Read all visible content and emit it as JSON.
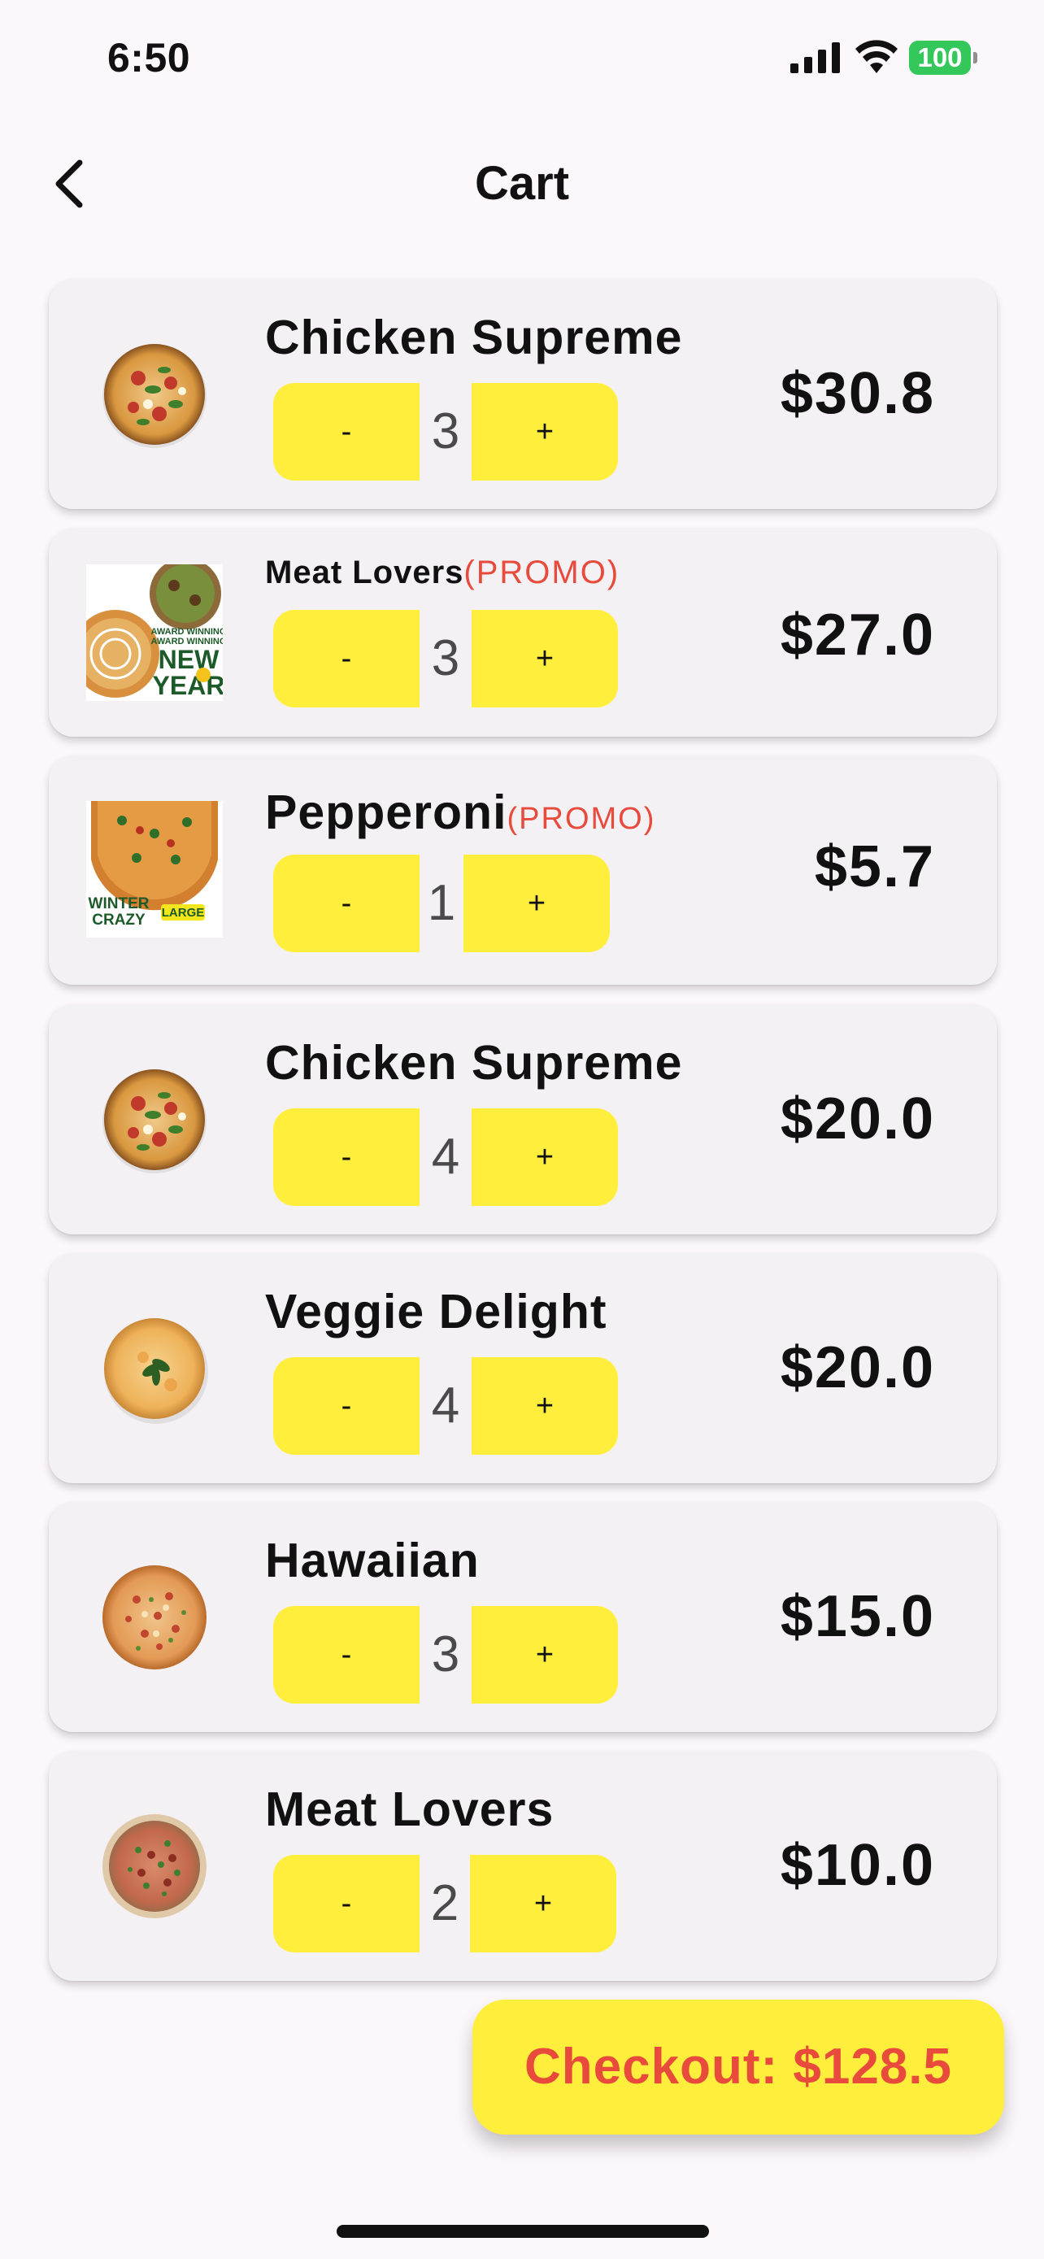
{
  "status_bar": {
    "time": "6:50",
    "battery": "100"
  },
  "header": {
    "title": "Cart"
  },
  "stepper": {
    "minus_label": "-",
    "plus_label": "+"
  },
  "items": [
    {
      "name": "Chicken Supreme",
      "promo": "",
      "quantity": "3",
      "price": "$30.8",
      "image": "pizza-supreme"
    },
    {
      "name": "Meat Lovers",
      "promo": "(PROMO)",
      "quantity": "3",
      "price": "$27.0",
      "image": "promo-new-year",
      "promo_image_text": [
        "AWARD WINNING",
        "AWARD WINNING",
        "NEW",
        "YEAR"
      ]
    },
    {
      "name": "Pepperoni",
      "promo": "(PROMO)",
      "quantity": "1",
      "price": "$5.7",
      "image": "promo-winter-crazy",
      "promo_image_text": [
        "WINTER",
        "CRAZY",
        "LARGE"
      ]
    },
    {
      "name": "Chicken Supreme",
      "promo": "",
      "quantity": "4",
      "price": "$20.0",
      "image": "pizza-supreme"
    },
    {
      "name": "Veggie Delight",
      "promo": "",
      "quantity": "4",
      "price": "$20.0",
      "image": "pizza-margherita"
    },
    {
      "name": "Hawaiian",
      "promo": "",
      "quantity": "3",
      "price": "$15.0",
      "image": "pizza-hawaiian"
    },
    {
      "name": "Meat Lovers",
      "promo": "",
      "quantity": "2",
      "price": "$10.0",
      "image": "pizza-meat"
    }
  ],
  "checkout": {
    "label": "Checkout: $128.5"
  },
  "colors": {
    "accent_yellow": "#ffee3c",
    "promo_red": "#e84a3c",
    "card_bg": "#f4f1f5",
    "page_bg": "#fcf7fb",
    "battery_green": "#34c759"
  }
}
